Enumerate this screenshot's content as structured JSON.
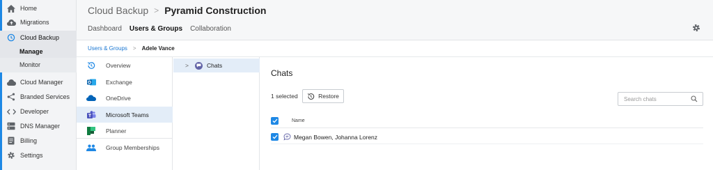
{
  "sidebar": {
    "items": [
      {
        "label": "Home",
        "icon": "home-icon"
      },
      {
        "label": "Migrations",
        "icon": "cloud-upload-icon"
      },
      {
        "label": "Cloud Backup",
        "icon": "backup-history-icon"
      },
      {
        "label": "Cloud Manager",
        "icon": "cloud-icon"
      },
      {
        "label": "Branded Services",
        "icon": "share-icon"
      },
      {
        "label": "Developer",
        "icon": "code-icon"
      },
      {
        "label": "DNS Manager",
        "icon": "server-icon"
      },
      {
        "label": "Billing",
        "icon": "document-icon"
      },
      {
        "label": "Settings",
        "icon": "gear-icon"
      }
    ],
    "sub_items": [
      {
        "label": "Manage"
      },
      {
        "label": "Monitor"
      }
    ]
  },
  "header": {
    "breadcrumb_root": "Cloud Backup",
    "breadcrumb_sep": ">",
    "breadcrumb_current": "Pyramid Construction",
    "tabs": [
      {
        "label": "Dashboard"
      },
      {
        "label": "Users & Groups"
      },
      {
        "label": "Collaboration"
      }
    ]
  },
  "subbreadcrumb": {
    "link": "Users & Groups",
    "sep": ">",
    "current": "Adele Vance"
  },
  "services": [
    {
      "label": "Overview",
      "icon": "history-icon"
    },
    {
      "label": "Exchange",
      "icon": "outlook-icon"
    },
    {
      "label": "OneDrive",
      "icon": "onedrive-icon"
    },
    {
      "label": "Microsoft Teams",
      "icon": "teams-icon"
    },
    {
      "label": "Planner",
      "icon": "planner-icon"
    },
    {
      "label": "Group Memberships",
      "icon": "people-icon"
    }
  ],
  "tree": {
    "chevron": ">",
    "label": "Chats"
  },
  "main": {
    "title": "Chats",
    "selected_count": "1 selected",
    "restore_label": "Restore",
    "search_placeholder": "Search chats",
    "column_name": "Name",
    "rows": [
      {
        "name": "Megan Bowen, Johanna Lorenz"
      }
    ]
  },
  "colors": {
    "accent": "#1e88e5",
    "teams": "#6264a7",
    "active_bg": "#e3edf8"
  }
}
